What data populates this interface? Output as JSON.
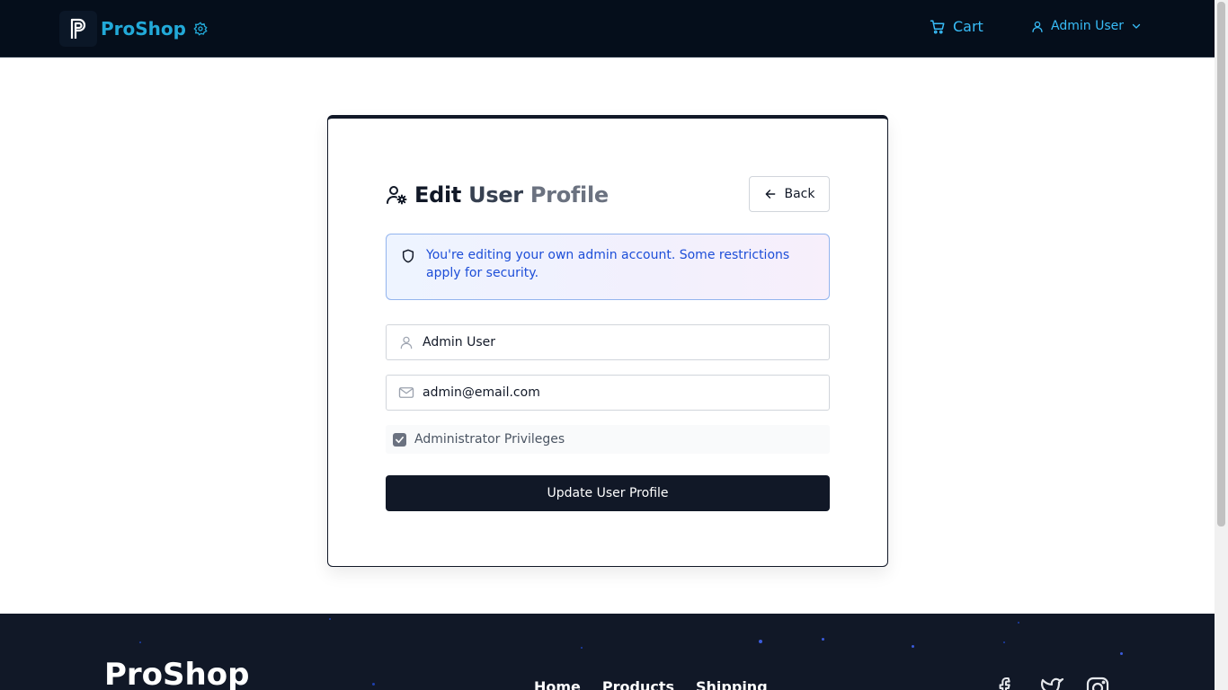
{
  "brand": {
    "name": "ProShop",
    "logo_letter": "P",
    "logo_icon": "p-logo-icon",
    "settings_icon": "gear-icon"
  },
  "nav": {
    "cart": {
      "label": "Cart",
      "icon": "cart-icon"
    },
    "user": {
      "label": "Admin User",
      "icon": "user-icon",
      "chevron": "chevron-down-icon"
    }
  },
  "form": {
    "title_parts": [
      "Edit",
      "User",
      "Profile"
    ],
    "title_icon": "user-gear-icon",
    "back_label": "Back",
    "alert": {
      "icon": "shield-icon",
      "text": "You're editing your own admin account. Some restrictions apply for security."
    },
    "name": {
      "value": "Admin User",
      "icon": "user-icon"
    },
    "email": {
      "value": "admin@email.com",
      "icon": "mail-icon"
    },
    "admin": {
      "label": "Administrator Privileges",
      "checked": true
    },
    "submit_label": "Update User Profile"
  },
  "footer": {
    "brand": "ProShop",
    "links": [
      "Home",
      "Products",
      "Shipping"
    ],
    "social": [
      "facebook-icon",
      "twitter-icon",
      "instagram-icon"
    ]
  },
  "colors": {
    "nav_bg": "#050e1b",
    "accent": "#22a9d8",
    "primary": "#111827",
    "alert_text": "#1d4ed8"
  }
}
